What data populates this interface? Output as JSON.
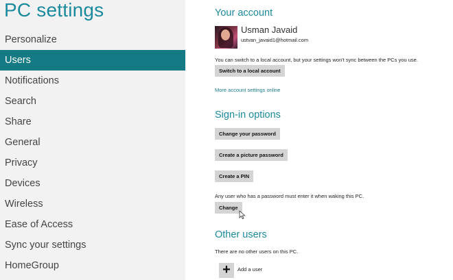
{
  "left": {
    "title": "PC settings",
    "nav": [
      {
        "label": "Personalize",
        "active": false
      },
      {
        "label": "Users",
        "active": true
      },
      {
        "label": "Notifications",
        "active": false
      },
      {
        "label": "Search",
        "active": false
      },
      {
        "label": "Share",
        "active": false
      },
      {
        "label": "General",
        "active": false
      },
      {
        "label": "Privacy",
        "active": false
      },
      {
        "label": "Devices",
        "active": false
      },
      {
        "label": "Wireless",
        "active": false
      },
      {
        "label": "Ease of Access",
        "active": false
      },
      {
        "label": "Sync your settings",
        "active": false
      },
      {
        "label": "HomeGroup",
        "active": false
      }
    ]
  },
  "account": {
    "heading": "Your account",
    "user_name": "Usman Javaid",
    "user_email": "ustvan_javaid1@hotmail.com",
    "switch_note": "You can switch to a local account, but your settings won't sync between the PCs you use.",
    "switch_button": "Switch to a local account",
    "more_link": "More account settings online"
  },
  "signin": {
    "heading": "Sign-in options",
    "change_password_button": "Change your password",
    "picture_password_button": "Create a picture password",
    "pin_button": "Create a PIN",
    "waking_note": "Any user who has a password must enter it when waking this PC.",
    "change_button": "Change"
  },
  "other_users": {
    "heading": "Other users",
    "note": "There are no other users on this PC.",
    "add_label": "Add a user",
    "add_icon_glyph": "+"
  },
  "colors": {
    "accent": "#1b8a9c",
    "active_nav": "#147a83",
    "sidebar_bg": "#f2f2f2",
    "button_bg": "#d4d4d4"
  }
}
